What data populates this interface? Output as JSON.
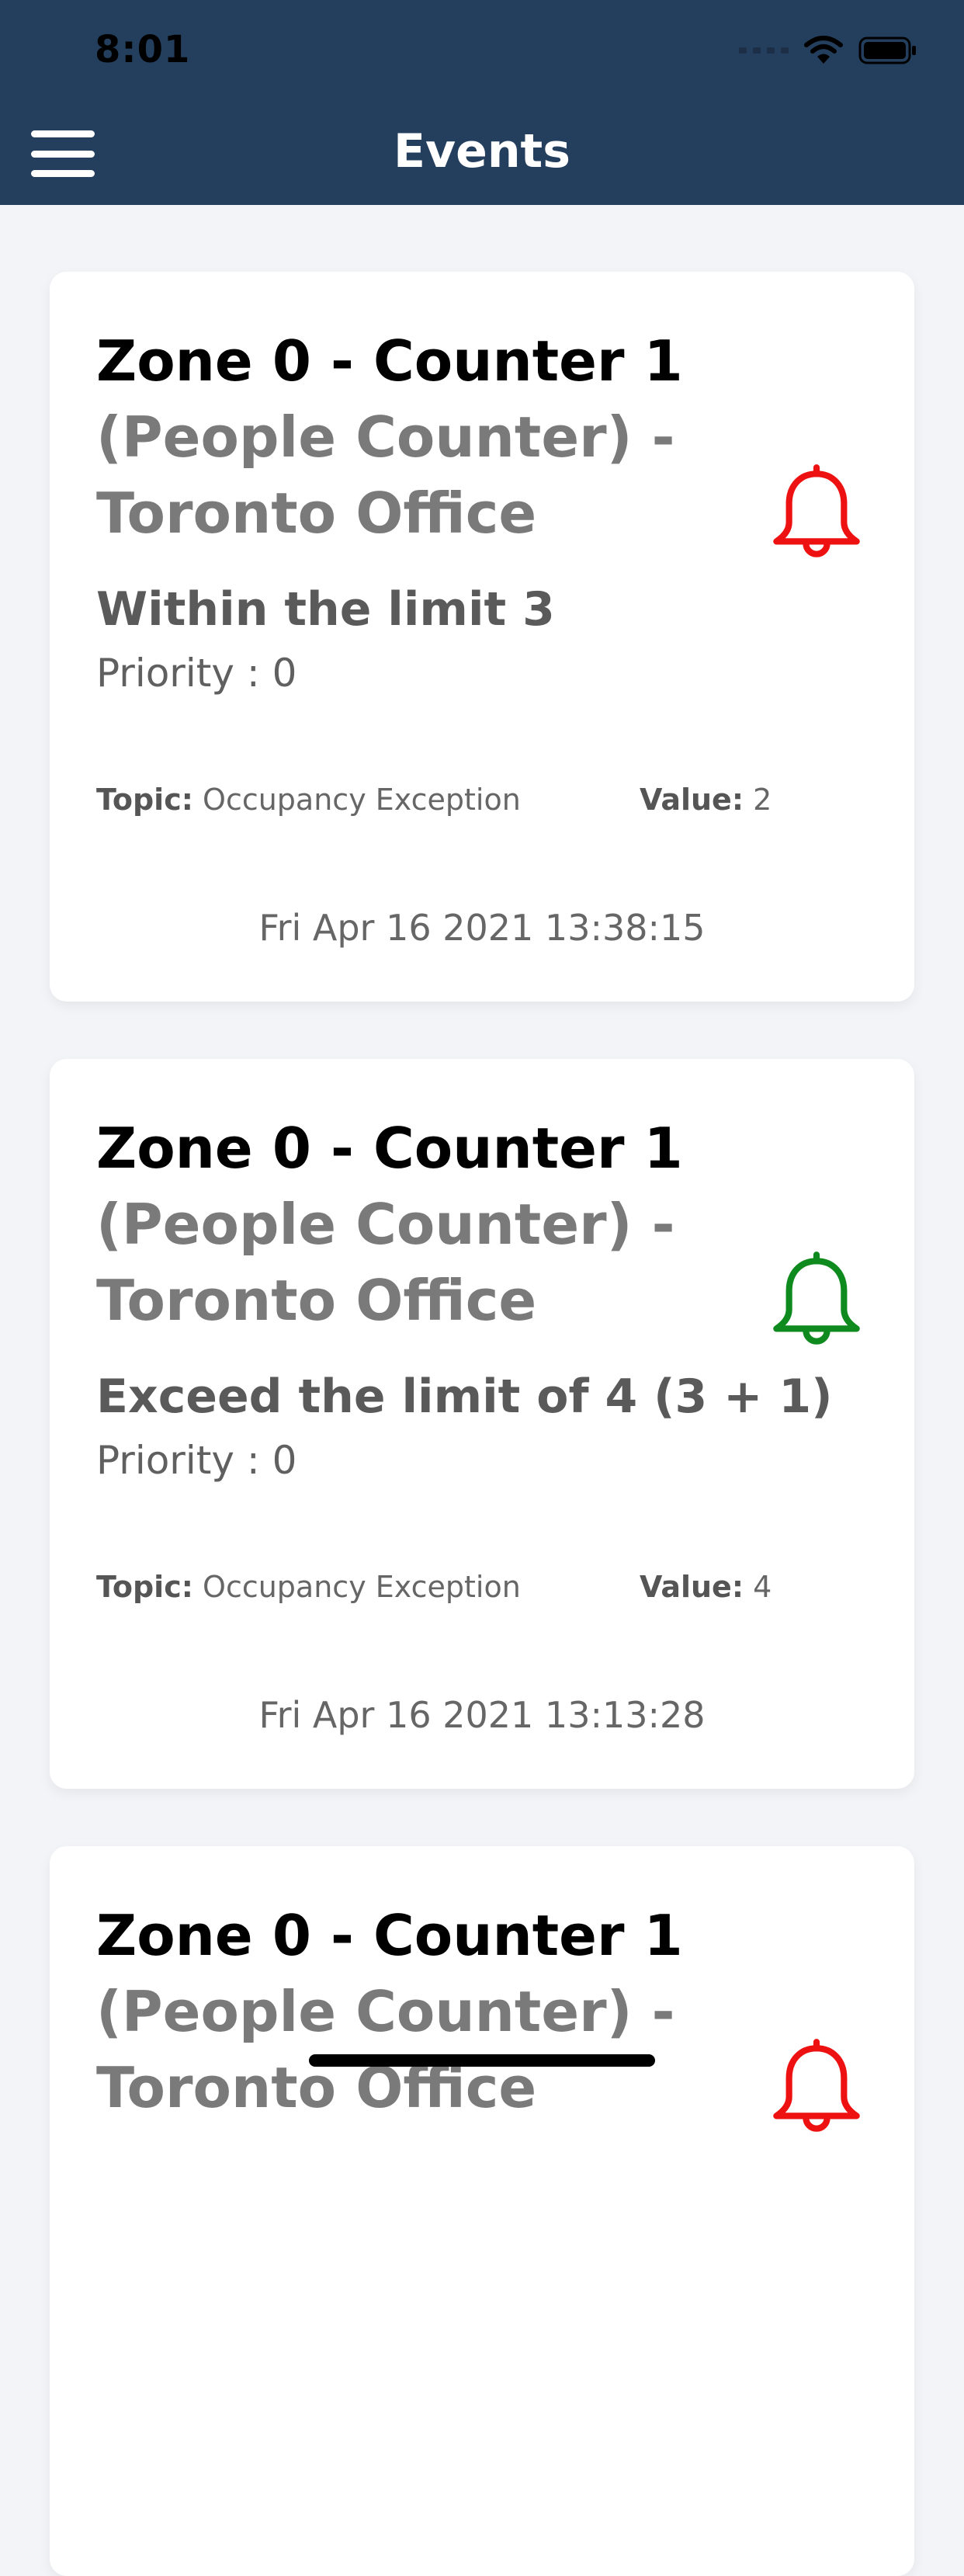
{
  "status_bar": {
    "time": "8:01"
  },
  "header": {
    "title": "Events",
    "background": "#243f5e"
  },
  "labels": {
    "topic": "Topic:",
    "value": "Value:",
    "priority_prefix": "Priority : "
  },
  "events": [
    {
      "zone": "Zone 0 - Counter 1",
      "location": "(People Counter) - Toronto Office",
      "message": "Within the limit 3",
      "priority": "Priority : 0",
      "topic": "Occupancy Exception",
      "value": "2",
      "date": "Fri Apr 16 2021 13:38:15",
      "bell_icon": "bell-icon",
      "bell_color": "#ee1111"
    },
    {
      "zone": "Zone 0 - Counter 1",
      "location": "(People Counter) - Toronto Office",
      "message": "Exceed the limit of 4 (3 + 1)",
      "priority": "Priority : 0",
      "topic": "Occupancy Exception",
      "value": "4",
      "date": "Fri Apr 16 2021 13:13:28",
      "bell_icon": "bell-icon",
      "bell_color": "#0f8a1e"
    },
    {
      "zone": "Zone 0 - Counter 1",
      "location": "(People Counter) - Toronto Office",
      "bell_icon": "bell-icon",
      "bell_color": "#ee1111"
    }
  ]
}
